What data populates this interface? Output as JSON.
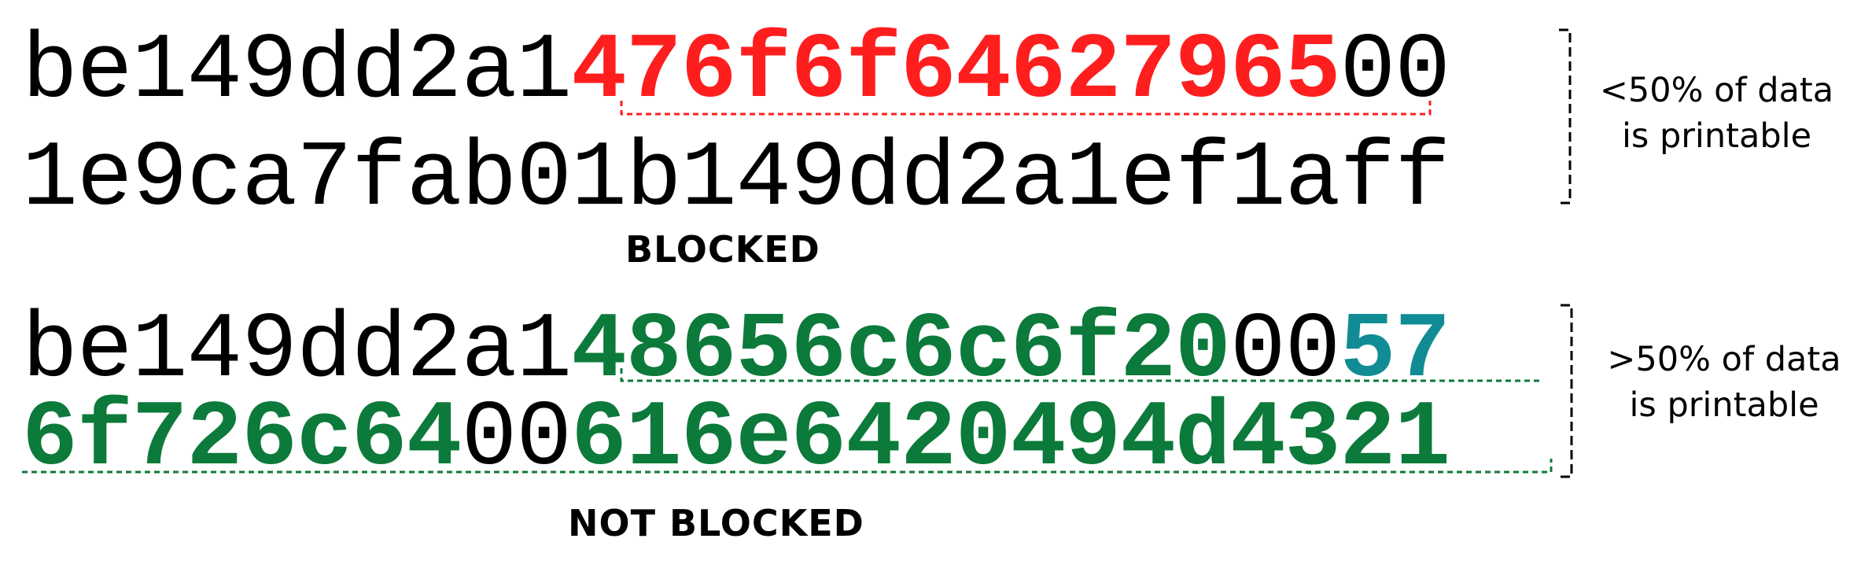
{
  "colors": {
    "default": "#000000",
    "blocked_highlight": "#ff1e1e",
    "printable_highlight": "#0c7a3a",
    "extra_highlight": "#118c95"
  },
  "example_blocked": {
    "line1": [
      {
        "text": "be149dd2a1",
        "color": "#000000"
      },
      {
        "text": "476f6f64627965",
        "color": "#ff1e1e"
      },
      {
        "text": "00",
        "color": "#000000"
      }
    ],
    "line2": [
      {
        "text": "1e9ca7fab01b149dd2a1ef1aff",
        "color": "#000000"
      }
    ],
    "status": "BLOCKED",
    "note_line1": "<50% of data",
    "note_line2": "is printable"
  },
  "example_not_blocked": {
    "line1": [
      {
        "text": "be149dd2a1",
        "color": "#000000"
      },
      {
        "text": "48656c6c6f20",
        "color": "#0c7a3a"
      },
      {
        "text": "00",
        "color": "#000000"
      },
      {
        "text": "57",
        "color": "#118c95"
      }
    ],
    "line2": [
      {
        "text": "6f726c64",
        "color": "#0c7a3a"
      },
      {
        "text": "00",
        "color": "#000000"
      },
      {
        "text": "616e6420494d4321",
        "color": "#0c7a3a"
      }
    ],
    "status": "NOT BLOCKED",
    "note_line1": ">50% of data",
    "note_line2": "is printable"
  }
}
